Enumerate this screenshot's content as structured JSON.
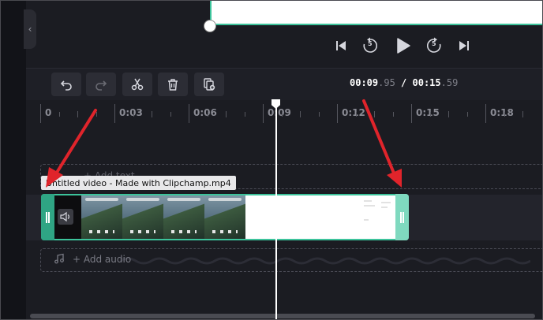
{
  "sidebar": {
    "collapse_icon": "chevron-left-icon",
    "collapse_glyph": "‹"
  },
  "playback": {
    "skip_back_icon": "skip-back-icon",
    "rewind_icon": "rewind-5-icon",
    "rewind_label": "5",
    "play_icon": "play-icon",
    "forward_icon": "forward-5-icon",
    "forward_label": "5",
    "skip_forward_icon": "skip-forward-icon"
  },
  "toolbar": {
    "undo_icon": "undo-icon",
    "redo_icon": "redo-icon",
    "split_icon": "scissors-icon",
    "delete_icon": "trash-icon",
    "duplicate_icon": "duplicate-icon"
  },
  "time": {
    "current_main": "00:09",
    "current_frac": ".95",
    "separator": " / ",
    "total_main": "00:15",
    "total_frac": ".59"
  },
  "ruler": {
    "ticks": [
      "0",
      "0:03",
      "0:06",
      "0:09",
      "0:12",
      "0:15",
      "0:18"
    ]
  },
  "tracks": {
    "text_label": "+ Add text",
    "clip_tooltip": "Untitled video - Made with Clipchamp.mp4",
    "audio_label": "+ Add audio"
  },
  "colors": {
    "accent": "#3cc39b",
    "annotation_arrow": "#e0242b",
    "background": "#1b1c22"
  }
}
